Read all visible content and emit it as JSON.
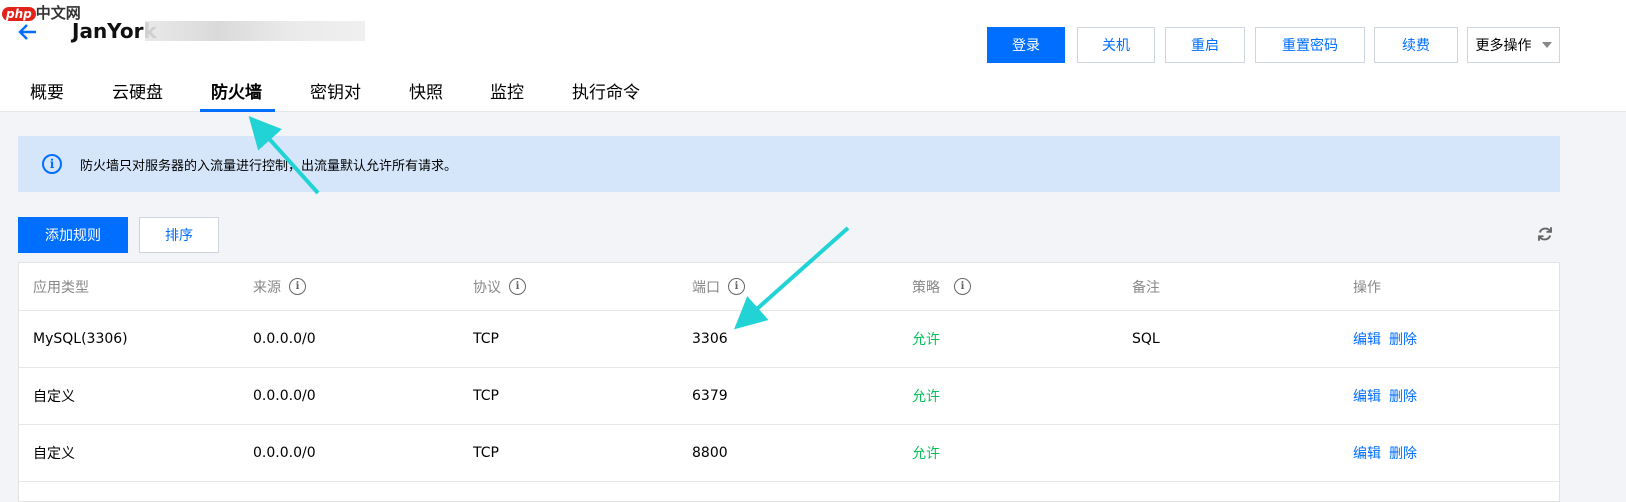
{
  "watermark": {
    "p": "php",
    "rest": "中文网"
  },
  "header": {
    "title": "JanYork"
  },
  "actions": [
    "登录",
    "关机",
    "重启",
    "重置密码",
    "续费",
    "更多操作"
  ],
  "tabs": [
    "概要",
    "云硬盘",
    "防火墙",
    "密钥对",
    "快照",
    "监控",
    "执行命令"
  ],
  "active_tab": "防火墙",
  "info": {
    "text": "防火墙只对服务器的入流量进行控制，出流量默认允许所有请求。"
  },
  "toolbar": {
    "add": "添加规则",
    "sort": "排序"
  },
  "table": {
    "headers": [
      "应用类型",
      "来源",
      "协议",
      "端口",
      "策略",
      "备注",
      "操作"
    ],
    "rows": [
      {
        "type": "MySQL(3306)",
        "source": "0.0.0.0/0",
        "protocol": "TCP",
        "port": "3306",
        "policy": "允许",
        "note": "SQL",
        "edit": "编辑",
        "delete": "删除"
      },
      {
        "type": "自定义",
        "source": "0.0.0.0/0",
        "protocol": "TCP",
        "port": "6379",
        "policy": "允许",
        "note": "",
        "edit": "编辑",
        "delete": "删除"
      },
      {
        "type": "自定义",
        "source": "0.0.0.0/0",
        "protocol": "TCP",
        "port": "8800",
        "policy": "允许",
        "note": "",
        "edit": "编辑",
        "delete": "删除"
      }
    ]
  },
  "colors": {
    "accent": "#006eff",
    "allow": "#0abf5b",
    "info_bg": "#d5e6fb",
    "annotation": "#22d3d6"
  }
}
